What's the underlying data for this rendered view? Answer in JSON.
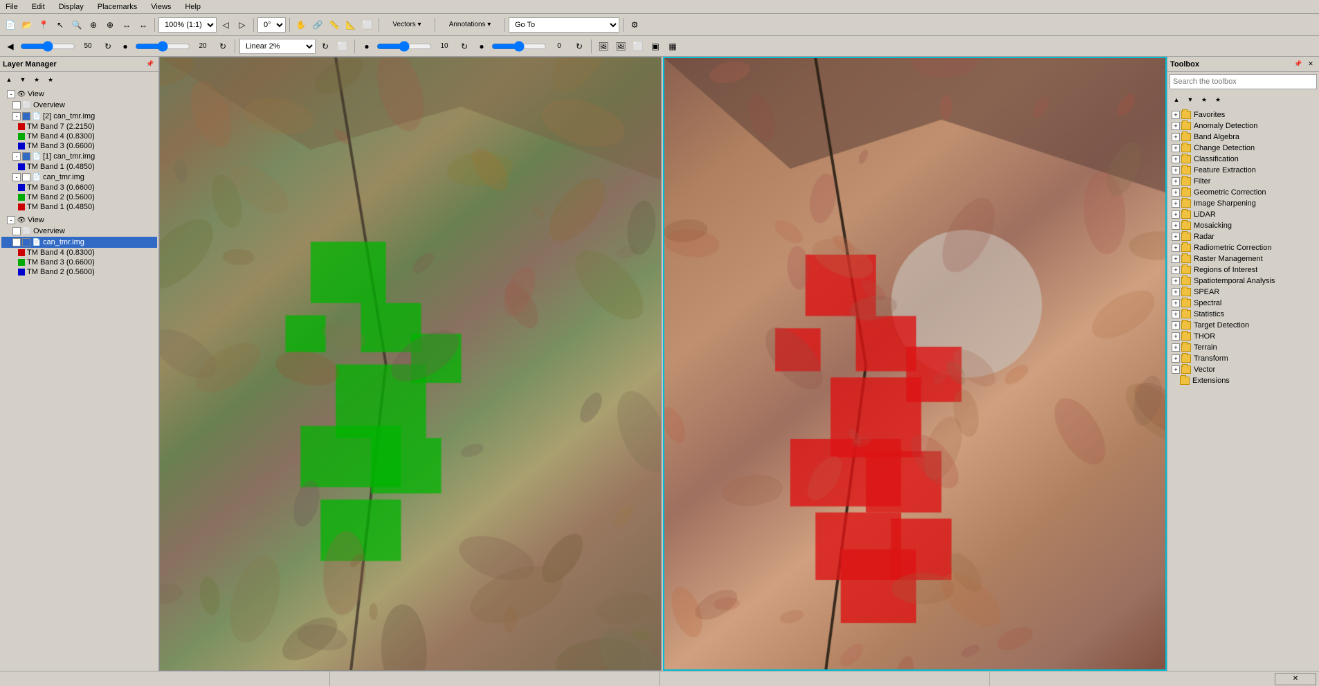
{
  "menubar": {
    "items": [
      "File",
      "Edit",
      "Display",
      "Placemarks",
      "Views",
      "Help"
    ]
  },
  "toolbar1": {
    "zoom_dropdown": "100% (1:1)",
    "rotation_dropdown": "0°",
    "vectors_btn": "Vectors ▾",
    "annotations_btn": "Annotations ▾",
    "goto_dropdown": "Go To"
  },
  "toolbar2": {
    "stretch_dropdown": "Linear 2%",
    "value1": "50",
    "value2": "20",
    "value3": "10",
    "value4": "0"
  },
  "layer_manager": {
    "title": "Layer Manager",
    "groups": [
      {
        "type": "view",
        "label": "View",
        "indent": 0,
        "children": [
          {
            "type": "overview",
            "label": "Overview",
            "indent": 1
          },
          {
            "type": "file",
            "label": "[2] can_tmr.img",
            "indent": 1,
            "checked": true,
            "bands": [
              {
                "color": "#cc0000",
                "label": "TM Band 7 (2.2150)"
              },
              {
                "color": "#00aa00",
                "label": "TM Band 4 (0.8300)"
              },
              {
                "color": "#0000cc",
                "label": "TM Band 3 (0.6600)"
              }
            ]
          },
          {
            "type": "file",
            "label": "[1] can_tmr.img",
            "indent": 1,
            "checked": true,
            "bands": [
              {
                "color": "#0000cc",
                "label": "TM Band 1 (0.4850)"
              }
            ]
          },
          {
            "type": "file",
            "label": "can_tmr.img",
            "indent": 1,
            "checked": false,
            "bands": [
              {
                "color": "#0000cc",
                "label": "TM Band 3 (0.6600)"
              },
              {
                "color": "#00aa00",
                "label": "TM Band 2 (0.5600)"
              },
              {
                "color": "#cc0000",
                "label": "TM Band 1 (0.4850)"
              }
            ]
          }
        ]
      },
      {
        "type": "view",
        "label": "View",
        "indent": 0,
        "children": [
          {
            "type": "overview",
            "label": "Overview",
            "indent": 1
          },
          {
            "type": "file",
            "label": "can_tmr.img",
            "indent": 1,
            "checked": true,
            "selected": true,
            "bands": [
              {
                "color": "#cc0000",
                "label": "TM Band 4 (0.8300)"
              },
              {
                "color": "#00aa00",
                "label": "TM Band 3 (0.6600)"
              },
              {
                "color": "#0000cc",
                "label": "TM Band 2 (0.5600)"
              }
            ]
          }
        ]
      }
    ]
  },
  "toolbox": {
    "title": "Toolbox",
    "search_placeholder": "Search the toolbox",
    "items": [
      {
        "label": "Favorites",
        "has_expand": true
      },
      {
        "label": "Anomaly Detection",
        "has_expand": true
      },
      {
        "label": "Band Algebra",
        "has_expand": true
      },
      {
        "label": "Change Detection",
        "has_expand": true
      },
      {
        "label": "Classification",
        "has_expand": true
      },
      {
        "label": "Feature Extraction",
        "has_expand": true
      },
      {
        "label": "Filter",
        "has_expand": true
      },
      {
        "label": "Geometric Correction",
        "has_expand": true
      },
      {
        "label": "Image Sharpening",
        "has_expand": true
      },
      {
        "label": "LiDAR",
        "has_expand": true
      },
      {
        "label": "Mosaicking",
        "has_expand": true
      },
      {
        "label": "Radar",
        "has_expand": true
      },
      {
        "label": "Radiometric Correction",
        "has_expand": true
      },
      {
        "label": "Raster Management",
        "has_expand": true
      },
      {
        "label": "Regions of Interest",
        "has_expand": true
      },
      {
        "label": "Spatiotemporal Analysis",
        "has_expand": true
      },
      {
        "label": "SPEAR",
        "has_expand": true
      },
      {
        "label": "Spectral",
        "has_expand": true
      },
      {
        "label": "Statistics",
        "has_expand": true
      },
      {
        "label": "Target Detection",
        "has_expand": true
      },
      {
        "label": "THOR",
        "has_expand": true
      },
      {
        "label": "Terrain",
        "has_expand": true
      },
      {
        "label": "Transform",
        "has_expand": true
      },
      {
        "label": "Vector",
        "has_expand": true
      },
      {
        "label": "Extensions",
        "has_expand": false
      }
    ]
  },
  "statusbar": {
    "panels": [
      "",
      "",
      "",
      ""
    ]
  },
  "icons": {
    "expand": "+",
    "collapse": "-",
    "close": "✕",
    "pin": "📌",
    "refresh": "↻",
    "up_arrow": "▲",
    "down_arrow": "▼",
    "add": "+",
    "minus": "−",
    "folder": "📁"
  }
}
